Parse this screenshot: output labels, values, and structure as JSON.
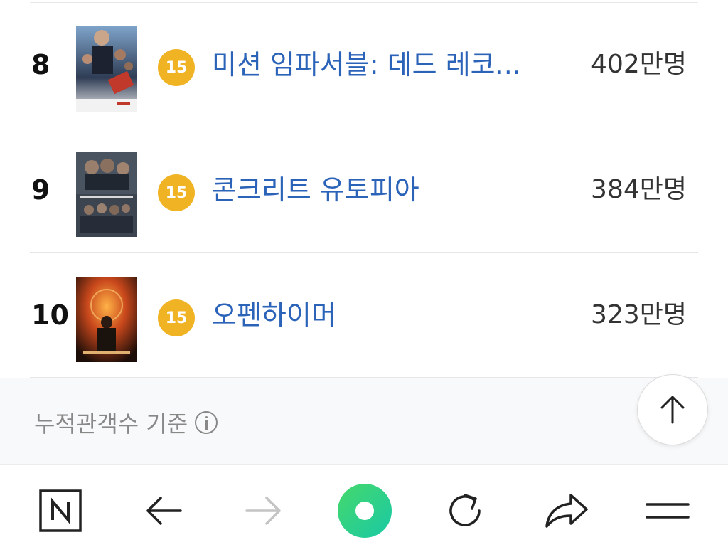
{
  "ranking": {
    "rows": [
      {
        "rank": "8",
        "age": "15",
        "title": "미션 임파서블: 데드 레코...",
        "count": "402만명",
        "poster": "mission-impossible-poster"
      },
      {
        "rank": "9",
        "age": "15",
        "title": "콘크리트 유토피아",
        "count": "384만명",
        "poster": "concrete-utopia-poster"
      },
      {
        "rank": "10",
        "age": "15",
        "title": "오펜하이머",
        "count": "323만명",
        "poster": "oppenheimer-poster"
      }
    ]
  },
  "footer": {
    "basis_label": "누적관객수 기준",
    "info_icon": "info-icon",
    "scroll_top_icon": "arrow-up-icon"
  },
  "navbar": {
    "items": [
      {
        "icon": "naver-home-icon",
        "label_glyph": "N"
      },
      {
        "icon": "back-arrow-icon"
      },
      {
        "icon": "forward-arrow-icon"
      },
      {
        "icon": "green-dot-icon"
      },
      {
        "icon": "refresh-icon"
      },
      {
        "icon": "share-icon"
      },
      {
        "icon": "menu-icon"
      }
    ]
  },
  "colors": {
    "title_blue": "#2b63b8",
    "age_badge": "#f0b323",
    "green_button": "#3ed16e",
    "text_dark": "#333333",
    "text_muted": "#888888"
  }
}
